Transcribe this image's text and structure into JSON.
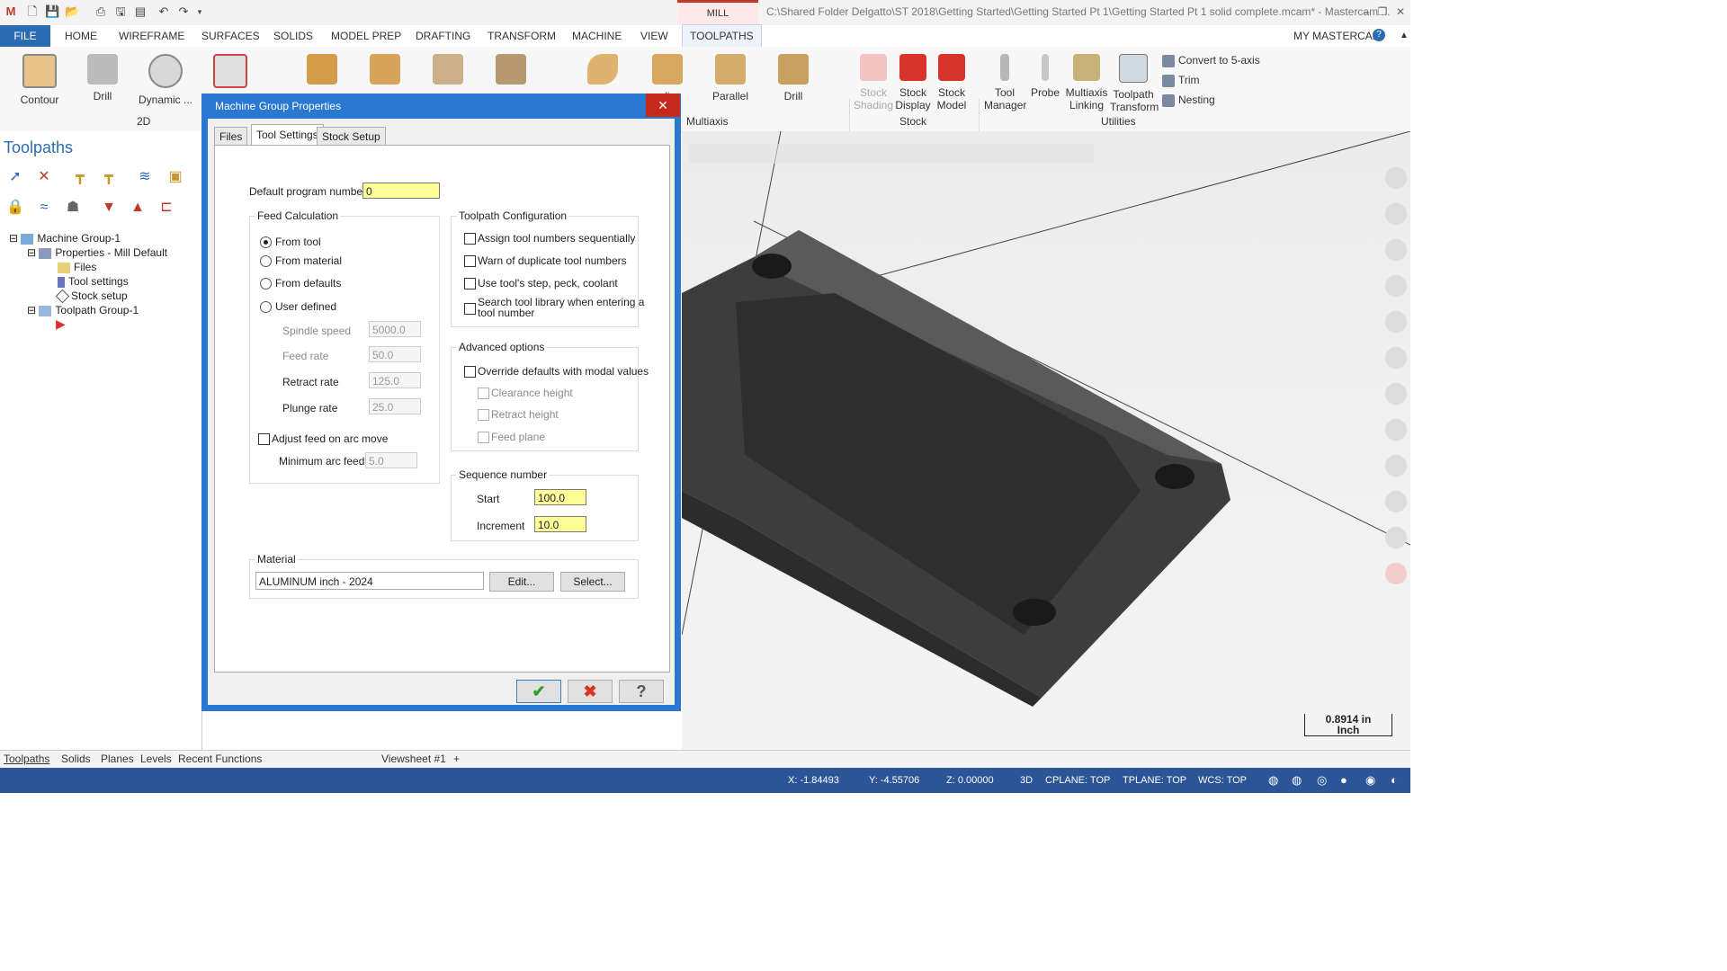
{
  "app": {
    "mode_tab": "MILL",
    "window_title": "C:\\Shared Folder Delgatto\\ST 2018\\Getting Started\\Getting Started Pt 1\\Getting Started Pt 1 solid complete.mcam* - Mastercam ...",
    "my_mastercam": "MY MASTERCAM",
    "help": "?"
  },
  "menu": [
    "FILE",
    "HOME",
    "WIREFRAME",
    "SURFACES",
    "SOLIDS",
    "MODEL PREP",
    "DRAFTING",
    "TRANSFORM",
    "MACHINE",
    "VIEW",
    "TOOLPATHS"
  ],
  "ribbon": {
    "two_d": [
      "Contour",
      "Drill",
      "Dynamic ..."
    ],
    "two_d_label": "2D",
    "multiaxis": [
      "...li...",
      "Parallel",
      "Drill"
    ],
    "multiaxis_label": "Multiaxis",
    "stock": [
      "Stock Shading",
      "Stock Display",
      "Stock Model"
    ],
    "stock_label": "Stock",
    "utilities": [
      "Tool Manager",
      "Probe",
      "Multiaxis Linking",
      "Toolpath Transform"
    ],
    "utilities_small": [
      "Convert to 5-axis",
      "Trim",
      "Nesting"
    ],
    "utilities_label": "Utilities"
  },
  "left_panel": {
    "title": "Toolpaths",
    "tree": [
      "Machine Group-1",
      "Properties - Mill Default",
      "Files",
      "Tool settings",
      "Stock setup",
      "Toolpath Group-1"
    ]
  },
  "bottom_tabs": [
    "Toolpaths",
    "Solids",
    "Planes",
    "Levels",
    "Recent Functions"
  ],
  "viewsheet": {
    "label": "Viewsheet #1",
    "add": "+"
  },
  "status": {
    "x": "X:  -1.84493",
    "y": "Y:  -4.55706",
    "z": "Z:  0.00000",
    "mode": "3D",
    "cplane": "CPLANE: TOP",
    "tplane": "TPLANE: TOP",
    "wcs": "WCS: TOP"
  },
  "scale": {
    "value": "0.8914 in",
    "unit": "Inch"
  },
  "dialog": {
    "title": "Machine Group Properties",
    "close": "✕",
    "tabs": [
      "Files",
      "Tool Settings",
      "Stock Setup"
    ],
    "default_program_label": "Default program number",
    "default_program_value": "0",
    "feed_calc": {
      "title": "Feed Calculation",
      "options": [
        "From tool",
        "From material",
        "From defaults",
        "User defined"
      ],
      "selected": "From tool",
      "spindle_label": "Spindle speed",
      "spindle_value": "5000.0",
      "feed_label": "Feed rate",
      "feed_value": "50.0",
      "retract_label": "Retract rate",
      "retract_value": "125.0",
      "plunge_label": "Plunge rate",
      "plunge_value": "25.0",
      "adjust_arc_label": "Adjust feed on arc move",
      "min_arc_label": "Minimum arc feed",
      "min_arc_value": "5.0"
    },
    "toolpath_config": {
      "title": "Toolpath Configuration",
      "options": [
        "Assign tool numbers sequentially",
        "Warn of duplicate tool numbers",
        "Use tool's step, peck, coolant",
        "Search tool library when entering a",
        "tool number"
      ]
    },
    "advanced": {
      "title": "Advanced options",
      "override": "Override defaults with modal values",
      "sub": [
        "Clearance height",
        "Retract height",
        "Feed plane"
      ]
    },
    "sequence": {
      "title": "Sequence number",
      "start_label": "Start",
      "start_value": "100.0",
      "increment_label": "Increment",
      "increment_value": "10.0"
    },
    "material": {
      "title": "Material",
      "value": "ALUMINUM inch - 2024",
      "edit": "Edit...",
      "select": "Select..."
    },
    "ok": "✔",
    "cancel": "✖",
    "help": "?"
  }
}
